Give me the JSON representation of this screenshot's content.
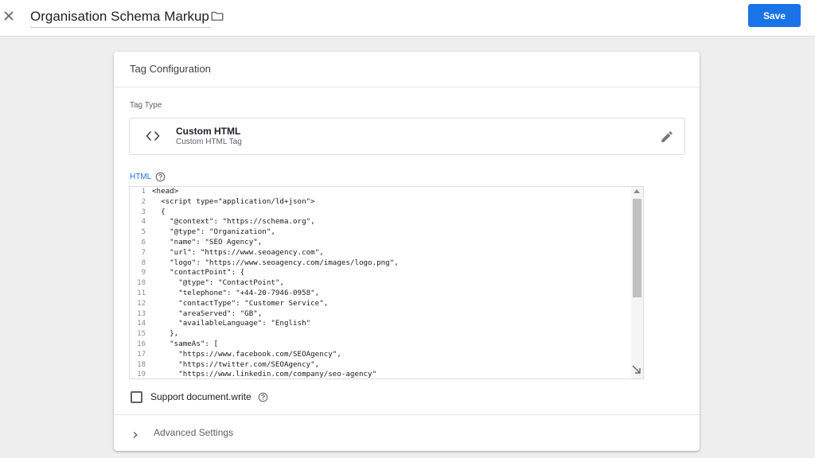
{
  "header": {
    "close_icon": "close-icon",
    "title": "Organisation Schema Markup",
    "folder_icon": "folder-icon",
    "save_label": "Save",
    "accent": "#1a73e8"
  },
  "card": {
    "title": "Tag Configuration",
    "tag_type_label": "Tag Type",
    "tag_type": {
      "icon": "code-brackets-icon",
      "name": "Custom HTML",
      "description": "Custom HTML Tag",
      "edit_icon": "pencil-icon"
    },
    "html_label": "HTML",
    "help_icon": "help-circle-icon",
    "editor": {
      "line_numbers": [
        "1",
        "2",
        "3",
        "4",
        "5",
        "6",
        "7",
        "8",
        "9",
        "10",
        "11",
        "12",
        "13",
        "14",
        "15",
        "16",
        "17",
        "18",
        "19"
      ],
      "lines": [
        "<head>",
        "  <script type=\"application/ld+json\">",
        "  {",
        "    \"@context\": \"https://schema.org\",",
        "    \"@type\": \"Organization\",",
        "    \"name\": \"SEO Agency\",",
        "    \"url\": \"https://www.seoagency.com\",",
        "    \"logo\": \"https://www.seoagency.com/images/logo.png\",",
        "    \"contactPoint\": {",
        "      \"@type\": \"ContactPoint\",",
        "      \"telephone\": \"+44-20-7946-0958\",",
        "      \"contactType\": \"Customer Service\",",
        "      \"areaServed\": \"GB\",",
        "      \"availableLanguage\": \"English\"",
        "    },",
        "    \"sameAs\": [",
        "      \"https://www.facebook.com/SEOAgency\",",
        "      \"https://twitter.com/SEOAgency\",",
        "      \"https://www.linkedin.com/company/seo-agency\""
      ]
    },
    "support_label": "Support document.write",
    "support_checked": false,
    "advanced_label": "Advanced Settings",
    "advanced_icon": "chevron-right-icon"
  }
}
